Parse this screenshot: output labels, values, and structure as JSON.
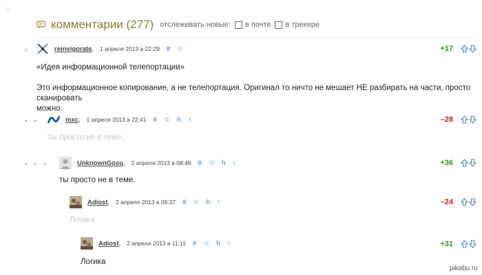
{
  "header": {
    "title": "комментарии (277)",
    "track_label": "отслеживать новые:",
    "options": [
      "в почте",
      "в трекере"
    ]
  },
  "comments": [
    {
      "author": "reinvigorate",
      "date": "1 апреля 2013 в 22:29",
      "score": "+17",
      "lines": [
        "«Идея информационной телепортации»",
        "",
        "Это информационное копирование, а не телепортация. Оригинал то ничто не мешает НЕ разбирать на части, просто сканировать",
        "можно."
      ]
    },
    {
      "author": "mxc",
      "date": "1 апреля 2013 в 22:41",
      "score": "–28",
      "lines": [
        "ты просто не в теме."
      ]
    },
    {
      "author": "UnknownGosu",
      "date": "2 апреля 2013 в 08:49",
      "score": "+36",
      "lines": [
        "ты просто не в теме."
      ]
    },
    {
      "author": "Adiost",
      "date": "2 апреля 2013 в 09:37",
      "score": "–24",
      "lines": [
        "Логика"
      ]
    },
    {
      "author": "Adiost",
      "date": "2 апреля 2013 в 11:11",
      "score": "+31",
      "lines": [
        "Логика"
      ]
    }
  ],
  "watermark": "pikabu.ru",
  "colors": {
    "positive": "#3a8a1e",
    "negative": "#c0201c",
    "title": "#8a7d3a",
    "link": "#3a7bc8"
  },
  "icons": [
    "comments-icon",
    "hash-icon",
    "star-icon",
    "reply-icon",
    "parent-icon",
    "vote-up-icon",
    "vote-down-icon"
  ]
}
